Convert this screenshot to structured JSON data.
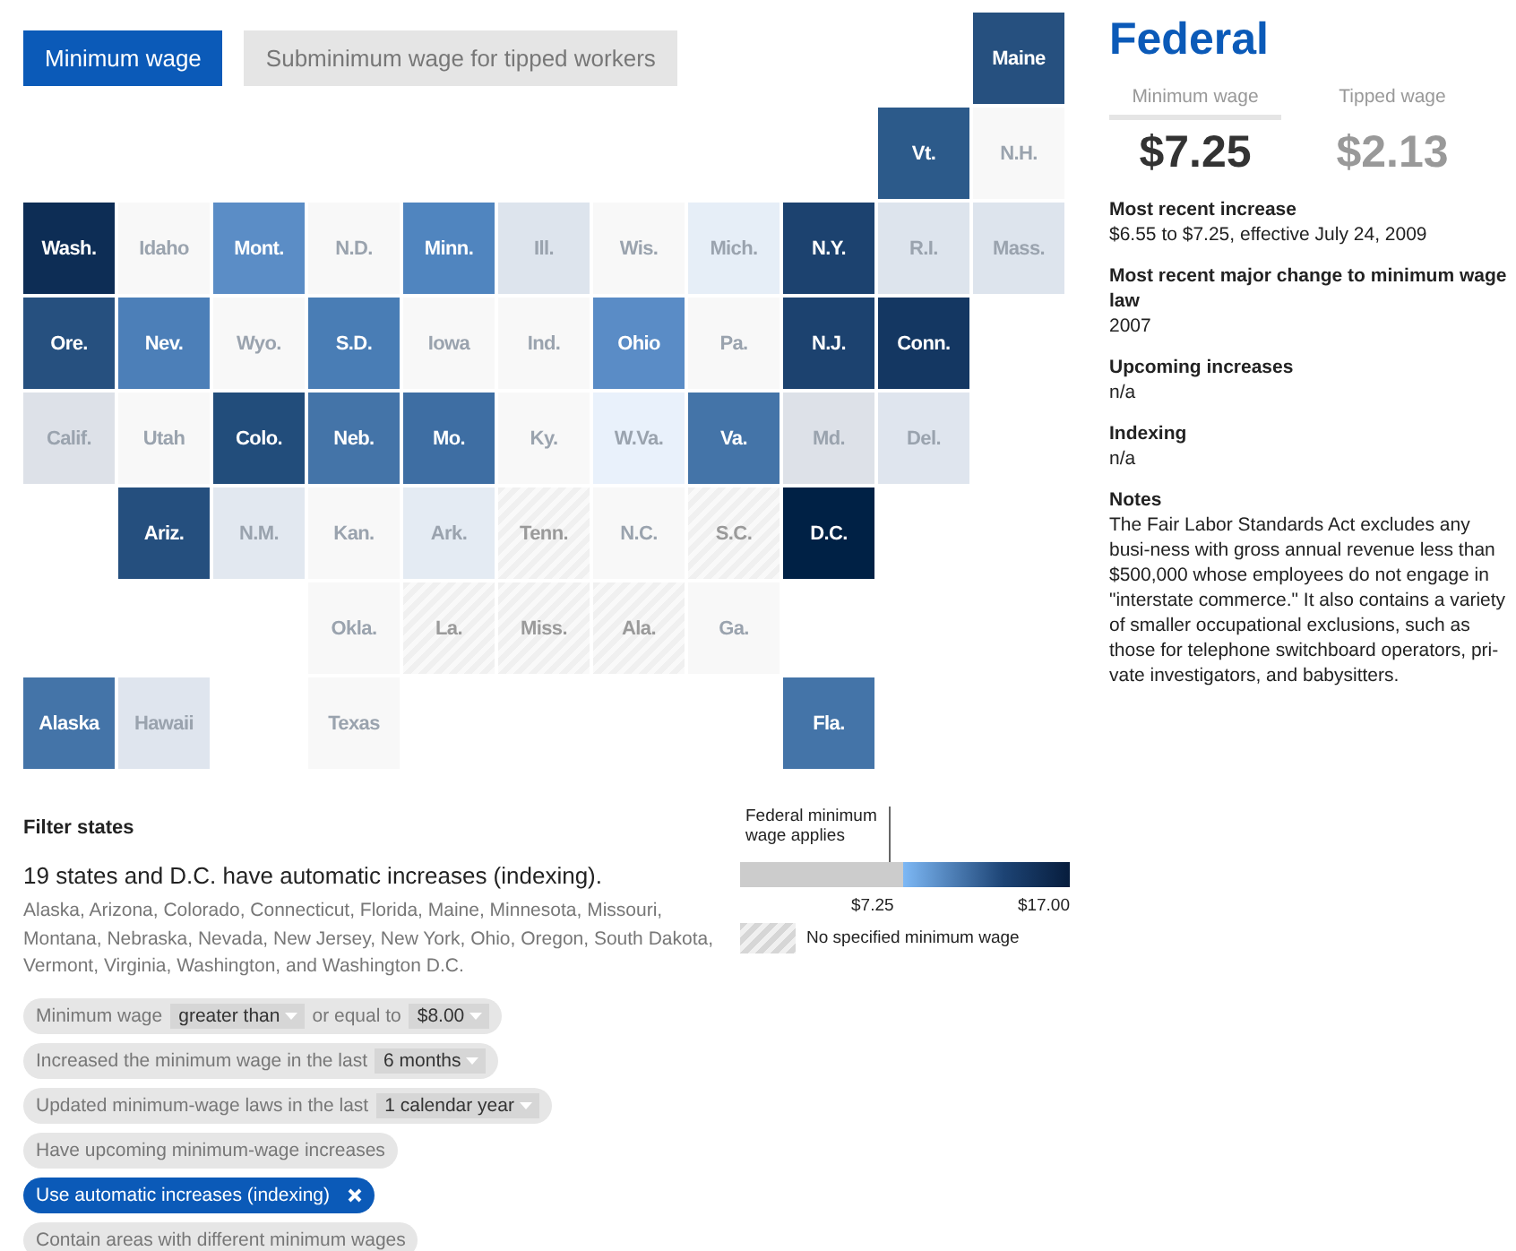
{
  "view_tabs": [
    {
      "label": "Minimum wage",
      "selected": true
    },
    {
      "label": "Subminimum wage for tipped workers",
      "selected": false
    }
  ],
  "map": {
    "rows": [
      [
        {
          "kind": "empty"
        },
        {
          "kind": "empty"
        },
        {
          "kind": "empty"
        },
        {
          "kind": "empty"
        },
        {
          "kind": "empty"
        },
        {
          "kind": "empty"
        },
        {
          "kind": "empty"
        },
        {
          "kind": "empty"
        },
        {
          "kind": "empty"
        },
        {
          "kind": "empty"
        },
        {
          "kind": "state",
          "label": "Maine",
          "color": "#26507f"
        }
      ],
      [
        {
          "kind": "empty"
        },
        {
          "kind": "empty"
        },
        {
          "kind": "empty"
        },
        {
          "kind": "empty"
        },
        {
          "kind": "empty"
        },
        {
          "kind": "empty"
        },
        {
          "kind": "empty"
        },
        {
          "kind": "empty"
        },
        {
          "kind": "empty"
        },
        {
          "kind": "state",
          "label": "Vt.",
          "color": "#2c5a8a"
        },
        {
          "kind": "state",
          "label": "N.H.",
          "color": "#f8f8f8"
        }
      ],
      [
        {
          "kind": "state",
          "label": "Wash.",
          "color": "#0d2d55"
        },
        {
          "kind": "state",
          "label": "Idaho",
          "color": "#f8f8f8"
        },
        {
          "kind": "state",
          "label": "Mont.",
          "color": "#5b8dc6"
        },
        {
          "kind": "state",
          "label": "N.D.",
          "color": "#f8f8f8"
        },
        {
          "kind": "state",
          "label": "Minn.",
          "color": "#5085bf"
        },
        {
          "kind": "state",
          "label": "Ill.",
          "color": "#dde4ed"
        },
        {
          "kind": "state",
          "label": "Wis.",
          "color": "#f8f8f8"
        },
        {
          "kind": "state",
          "label": "Mich.",
          "color": "#e6eef7"
        },
        {
          "kind": "state",
          "label": "N.Y.",
          "color": "#1c426f"
        },
        {
          "kind": "state",
          "label": "R.I.",
          "color": "#dde4ed"
        },
        {
          "kind": "state",
          "label": "Mass.",
          "color": "#dde4ed"
        }
      ],
      [
        {
          "kind": "state",
          "label": "Ore.",
          "color": "#26507f"
        },
        {
          "kind": "state",
          "label": "Nev.",
          "color": "#4c7fb8"
        },
        {
          "kind": "state",
          "label": "Wyo.",
          "color": "#f8f8f8"
        },
        {
          "kind": "state",
          "label": "S.D.",
          "color": "#497db5"
        },
        {
          "kind": "state",
          "label": "Iowa",
          "color": "#f8f8f8"
        },
        {
          "kind": "state",
          "label": "Ind.",
          "color": "#f8f8f8"
        },
        {
          "kind": "state",
          "label": "Ohio",
          "color": "#5a8cc6"
        },
        {
          "kind": "state",
          "label": "Pa.",
          "color": "#f8f8f8"
        },
        {
          "kind": "state",
          "label": "N.J.",
          "color": "#1c426f"
        },
        {
          "kind": "state",
          "label": "Conn.",
          "color": "#143762"
        }
      ],
      [
        {
          "kind": "state",
          "label": "Calif.",
          "color": "#dde1e8"
        },
        {
          "kind": "state",
          "label": "Utah",
          "color": "#f8f8f8"
        },
        {
          "kind": "state",
          "label": "Colo.",
          "color": "#224d7b"
        },
        {
          "kind": "state",
          "label": "Neb.",
          "color": "#4474a8"
        },
        {
          "kind": "state",
          "label": "Mo.",
          "color": "#3e6ea3"
        },
        {
          "kind": "state",
          "label": "Ky.",
          "color": "#f8f8f8"
        },
        {
          "kind": "state",
          "label": "W.Va.",
          "color": "#e9f1fb"
        },
        {
          "kind": "state",
          "label": "Va.",
          "color": "#4474a8"
        },
        {
          "kind": "state",
          "label": "Md.",
          "color": "#dde1e8"
        },
        {
          "kind": "state",
          "label": "Del.",
          "color": "#dfe5ee"
        }
      ],
      [
        {
          "kind": "empty"
        },
        {
          "kind": "state",
          "label": "Ariz.",
          "color": "#254f7e"
        },
        {
          "kind": "state",
          "label": "N.M.",
          "color": "#e2e8f0"
        },
        {
          "kind": "state",
          "label": "Kan.",
          "color": "#f8f8f8"
        },
        {
          "kind": "state",
          "label": "Ark.",
          "color": "#e4ebf3"
        },
        {
          "kind": "hatched",
          "label": "Tenn."
        },
        {
          "kind": "state",
          "label": "N.C.",
          "color": "#f8f8f8"
        },
        {
          "kind": "hatched",
          "label": "S.C."
        },
        {
          "kind": "state",
          "label": "D.C.",
          "color": "#002145"
        }
      ],
      [
        {
          "kind": "empty"
        },
        {
          "kind": "empty"
        },
        {
          "kind": "empty"
        },
        {
          "kind": "state",
          "label": "Okla.",
          "color": "#f8f8f8"
        },
        {
          "kind": "hatched",
          "label": "La."
        },
        {
          "kind": "hatched",
          "label": "Miss."
        },
        {
          "kind": "hatched",
          "label": "Ala."
        },
        {
          "kind": "state",
          "label": "Ga.",
          "color": "#f8f8f8"
        }
      ],
      [
        {
          "kind": "state",
          "label": "Alaska",
          "color": "#4474a8"
        },
        {
          "kind": "state",
          "label": "Hawaii",
          "color": "#dfe5ee"
        },
        {
          "kind": "empty"
        },
        {
          "kind": "state",
          "label": "Texas",
          "color": "#f8f8f8"
        },
        {
          "kind": "empty"
        },
        {
          "kind": "empty"
        },
        {
          "kind": "empty"
        },
        {
          "kind": "empty"
        },
        {
          "kind": "state",
          "label": "Fla.",
          "color": "#4474a8"
        }
      ]
    ]
  },
  "filter": {
    "heading": "Filter states",
    "summary": "19 states and D.C. have automatic increases (indexing).",
    "states_list": "Alaska, Arizona, Colorado, Connecticut, Florida, Maine, Minnesota, Missouri, Montana, Nebraska, Nevada, New Jersey, New York, Ohio, Oregon, South Dakota, Vermont, Virginia, Washington, and Washington D.C.",
    "chips": [
      {
        "selected": false,
        "parts": [
          {
            "kind": "text",
            "text": "Minimum wage"
          },
          {
            "kind": "select",
            "text": "greater than"
          },
          {
            "kind": "text",
            "text": "or equal to"
          },
          {
            "kind": "select",
            "text": "$8.00"
          }
        ]
      },
      {
        "selected": false,
        "parts": [
          {
            "kind": "text",
            "text": "Increased the minimum wage in the last"
          },
          {
            "kind": "select",
            "text": "6 months"
          }
        ]
      },
      {
        "selected": false,
        "parts": [
          {
            "kind": "text",
            "text": "Updated minimum-wage laws in the last"
          },
          {
            "kind": "select",
            "text": "1 calendar year"
          }
        ]
      },
      {
        "selected": false,
        "parts": [
          {
            "kind": "text",
            "text": "Have upcoming minimum-wage increases"
          }
        ]
      },
      {
        "selected": true,
        "parts": [
          {
            "kind": "text",
            "text": "Use automatic increases (indexing)"
          }
        ]
      },
      {
        "selected": false,
        "parts": [
          {
            "kind": "text",
            "text": "Contain areas with different minimum wages"
          }
        ]
      }
    ]
  },
  "legend": {
    "federal_label": "Federal minimum wage applies",
    "low_tick": "$7.25",
    "high_tick": "$17.00",
    "hatched_label": "No specified minimum wage"
  },
  "detail": {
    "title": "Federal",
    "wage_tabs": [
      {
        "label": "Minimum wage",
        "value": "$7.25",
        "selected": true
      },
      {
        "label": "Tipped wage",
        "value": "$2.13",
        "selected": false
      }
    ],
    "sections": [
      {
        "heading": "Most recent increase",
        "text": "$6.55 to $7.25, effective July 24, 2009"
      },
      {
        "heading": "Most recent major change to minimum wage law",
        "text": "2007"
      },
      {
        "heading": "Upcoming increases",
        "text": "n/a"
      },
      {
        "heading": "Indexing",
        "text": "n/a"
      },
      {
        "heading": "Notes",
        "text": "The Fair Labor Standards Act excludes any busi-ness with gross annual revenue less than $500,000 whose employees do not engage in \"interstate commerce.\" It also contains a variety of smaller occupational exclusions, such as those for telephone switchboard operators, pri-vate investigators, and babysitters."
      }
    ]
  }
}
